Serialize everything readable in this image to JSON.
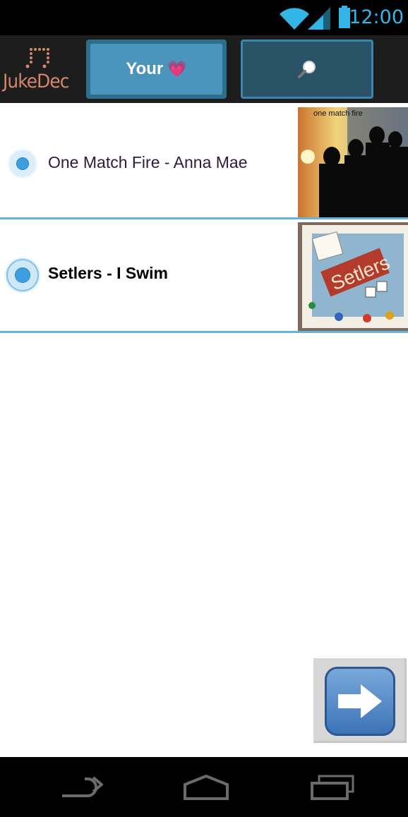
{
  "status_bar": {
    "time": "12:00"
  },
  "app": {
    "logo_text": "JukeDec"
  },
  "tabs": {
    "your_label": "Your",
    "your_emoji": "💗",
    "search_icon": "magnifier-icon"
  },
  "songs": [
    {
      "title": "One Match Fire - Anna Mae",
      "art_caption": "one match fire",
      "selected": false
    },
    {
      "title": "Setlers - I Swim",
      "art_caption": "Setlers",
      "selected": true
    }
  ],
  "fab": {
    "icon": "right-arrow-icon"
  },
  "nav": {
    "back": "back-icon",
    "home": "home-icon",
    "recents": "recents-icon"
  }
}
